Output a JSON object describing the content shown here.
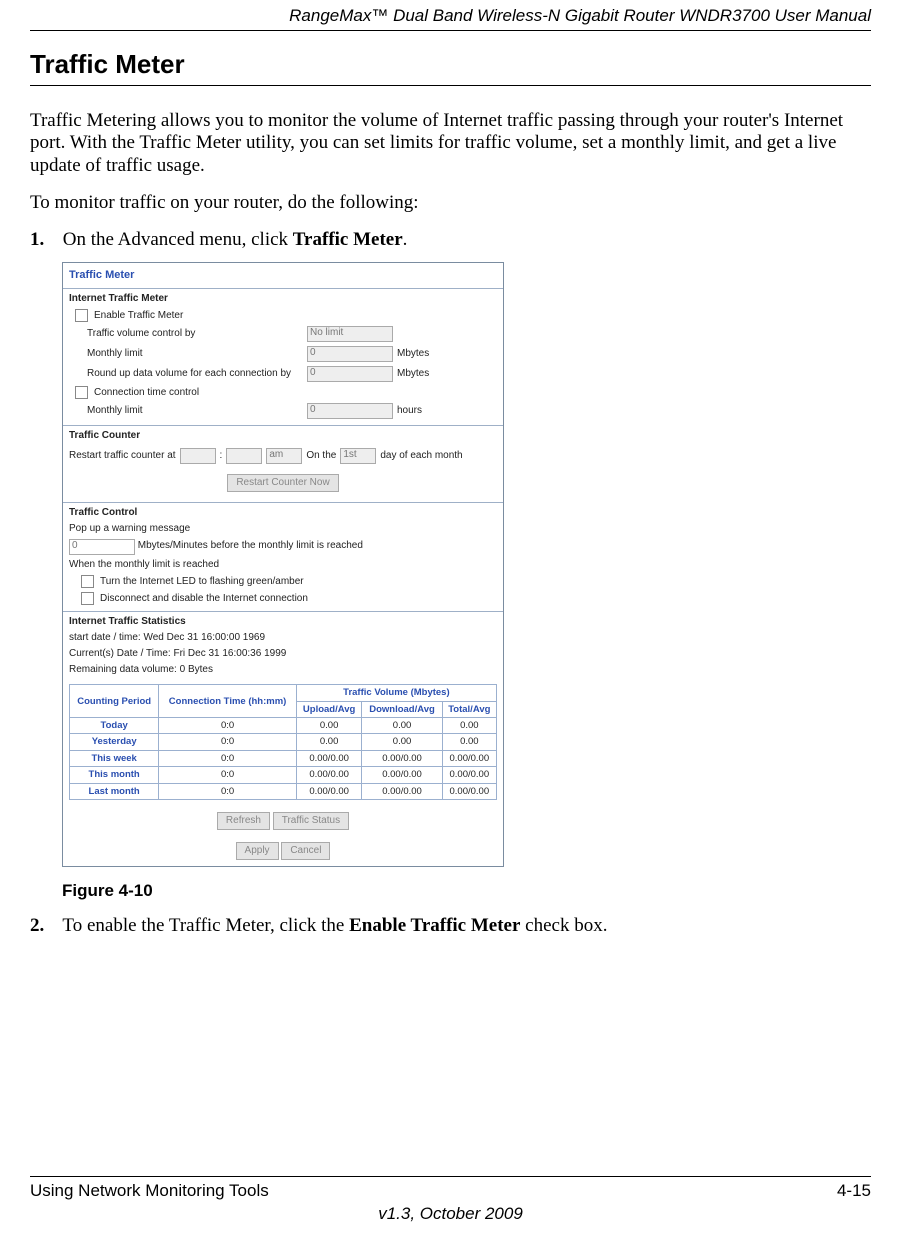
{
  "header": {
    "doc_title": "RangeMax™ Dual Band Wireless-N Gigabit Router WNDR3700 User Manual"
  },
  "section": {
    "title": "Traffic Meter",
    "intro": "Traffic Metering allows you to monitor the volume of Internet traffic passing through your router's Internet port. With the Traffic Meter utility, you can set limits for traffic volume, set a monthly limit, and get a live update of traffic usage.",
    "lead": "To monitor traffic on your router, do the following:"
  },
  "steps": {
    "s1_num": "1.",
    "s1_a": "On the Advanced menu, click ",
    "s1_b": "Traffic Meter",
    "s1_c": ".",
    "s2_num": "2.",
    "s2_a": "To enable the Traffic Meter, click the ",
    "s2_b": "Enable Traffic Meter",
    "s2_c": " check box."
  },
  "figure": {
    "caption": "Figure 4-10"
  },
  "shot": {
    "title": "Traffic Meter",
    "sec_itm": "Internet Traffic Meter",
    "enable": "Enable Traffic Meter",
    "vol_ctrl": "Traffic volume control by",
    "vol_ctrl_val": "No limit",
    "mlimit1": "Monthly limit",
    "mlimit1_val": "0",
    "mlimit1_unit": "Mbytes",
    "roundup": "Round up data volume for each connection by",
    "roundup_val": "0",
    "roundup_unit": "Mbytes",
    "conn_time": "Connection time control",
    "mlimit2": "Monthly limit",
    "mlimit2_val": "0",
    "mlimit2_unit": "hours",
    "sec_tc": "Traffic Counter",
    "restart_a": "Restart traffic counter at",
    "restart_hh": "",
    "restart_colon": ":",
    "restart_mm": "",
    "restart_ampm": "am",
    "restart_b": "On the",
    "restart_day": "1st",
    "restart_c": "day of each month",
    "restart_btn": "Restart Counter Now",
    "sec_tctrl": "Traffic Control",
    "popup": "Pop up a warning message",
    "popup_val": "0",
    "popup_tail": "Mbytes/Minutes before the monthly limit is reached",
    "whenreached": "When the monthly limit is reached",
    "led": "Turn the Internet LED to flashing green/amber",
    "disc": "Disconnect and disable the Internet connection",
    "sec_stats": "Internet Traffic Statistics",
    "start": "start date / time: Wed Dec 31 16:00:00 1969",
    "current": "Current(s) Date / Time: Fri Dec 31 16:00:36 1999",
    "remaining": "Remaining data volume: 0 Bytes",
    "tbl": {
      "h_period": "Counting Period",
      "h_conn": "Connection Time (hh:mm)",
      "h_vol": "Traffic Volume (Mbytes)",
      "h_up": "Upload/Avg",
      "h_down": "Download/Avg",
      "h_total": "Total/Avg",
      "rows": [
        {
          "p": "Today",
          "c": "0:0",
          "u": "0.00",
          "d": "0.00",
          "t": "0.00"
        },
        {
          "p": "Yesterday",
          "c": "0:0",
          "u": "0.00",
          "d": "0.00",
          "t": "0.00"
        },
        {
          "p": "This week",
          "c": "0:0",
          "u": "0.00/0.00",
          "d": "0.00/0.00",
          "t": "0.00/0.00"
        },
        {
          "p": "This month",
          "c": "0:0",
          "u": "0.00/0.00",
          "d": "0.00/0.00",
          "t": "0.00/0.00"
        },
        {
          "p": "Last month",
          "c": "0:0",
          "u": "0.00/0.00",
          "d": "0.00/0.00",
          "t": "0.00/0.00"
        }
      ]
    },
    "btn_refresh": "Refresh",
    "btn_status": "Traffic Status",
    "btn_apply": "Apply",
    "btn_cancel": "Cancel"
  },
  "footer": {
    "left": "Using Network Monitoring Tools",
    "right": "4-15",
    "center": "v1.3, October 2009"
  }
}
